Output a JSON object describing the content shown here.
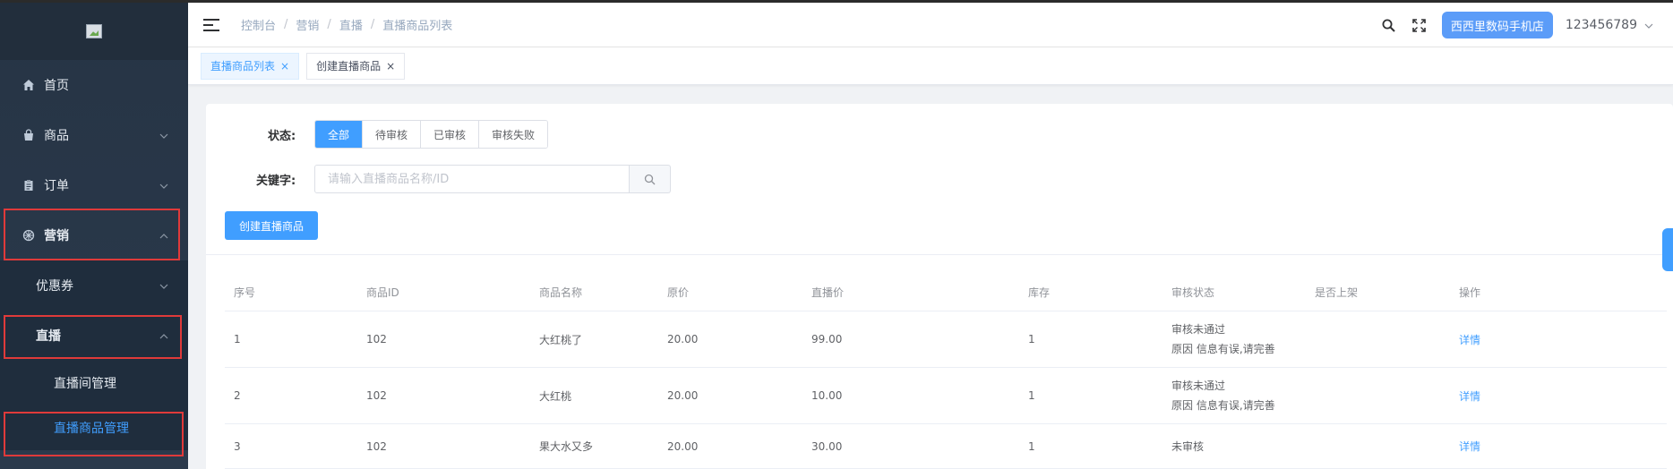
{
  "sidebar": {
    "home": "首页",
    "goods": "商品",
    "orders": "订单",
    "marketing": "营销",
    "coupons": "优惠券",
    "live": "直播",
    "live_room": "直播间管理",
    "live_goods": "直播商品管理"
  },
  "header": {
    "breadcrumb": [
      "控制台",
      "营销",
      "直播",
      "直播商品列表"
    ],
    "shop_name": "西西里数码手机店",
    "username": "123456789"
  },
  "tabs": [
    {
      "label": "直播商品列表",
      "active": true
    },
    {
      "label": "创建直播商品",
      "active": false
    }
  ],
  "filters": {
    "status_label": "状态:",
    "status_options": [
      "全部",
      "待审核",
      "已审核",
      "审核失败"
    ],
    "status_selected": "全部",
    "keyword_label": "关键字:",
    "keyword_placeholder": "请输入直播商品名称/ID",
    "keyword_value": ""
  },
  "create_button": "创建直播商品",
  "table": {
    "headers": [
      "序号",
      "商品ID",
      "商品名称",
      "原价",
      "直播价",
      "库存",
      "审核状态",
      "是否上架",
      "操作"
    ],
    "rows": [
      {
        "index": "1",
        "id": "102",
        "name": "大红桃了",
        "price": "20.00",
        "live_price": "99.00",
        "stock": "1",
        "status": "审核未通过",
        "reason": "原因 信息有误,请完善",
        "listed": "",
        "action": "详情"
      },
      {
        "index": "2",
        "id": "102",
        "name": "大红桃",
        "price": "20.00",
        "live_price": "10.00",
        "stock": "1",
        "status": "审核未通过",
        "reason": "原因 信息有误,请完善",
        "listed": "",
        "action": "详情"
      },
      {
        "index": "3",
        "id": "102",
        "name": "果大水又多",
        "price": "20.00",
        "live_price": "30.00",
        "stock": "1",
        "status": "未审核",
        "reason": "",
        "listed": "",
        "action": "详情"
      }
    ]
  },
  "colors": {
    "primary": "#409eff",
    "sidebar_bg": "#2b3a4c",
    "highlight_box": "#e03a3a",
    "shop_button": "#5b9cf8"
  }
}
